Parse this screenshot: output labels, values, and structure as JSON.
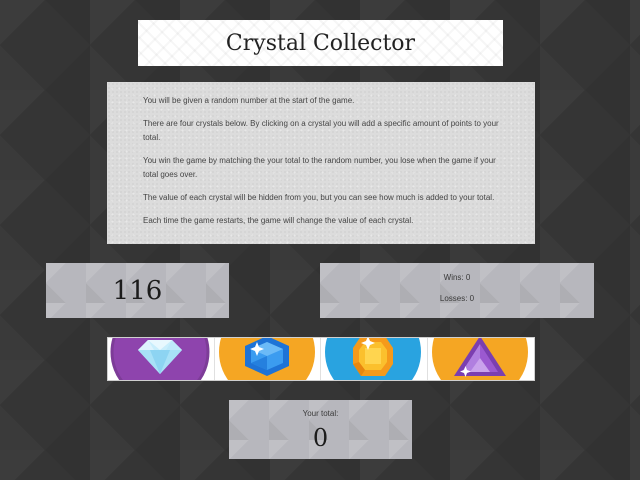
{
  "header": {
    "title": "Crystal Collector"
  },
  "instructions": [
    "You will be given a random number at the start of the game.",
    "There are four crystals below. By clicking on a crystal you will add a specific amount of points to your total.",
    "You win the game by matching the your total to the random number, you lose when the game if your total goes over.",
    "The value of each crystal will be hidden from you, but you can see how much is added to your total.",
    "Each time the game restarts, the game will change the value of each crystal."
  ],
  "target_number": "116",
  "scores": {
    "wins": "Wins: 0",
    "losses": "Losses: 0"
  },
  "crystals": [
    {
      "name": "diamond",
      "bg": "#8e44ad"
    },
    {
      "name": "blue-gem",
      "bg": "#f5a623"
    },
    {
      "name": "orange-gem",
      "bg": "#29a3e0"
    },
    {
      "name": "purple-gem",
      "bg": "#f5a623"
    }
  ],
  "total": {
    "label": "Your total:",
    "value": "0"
  }
}
